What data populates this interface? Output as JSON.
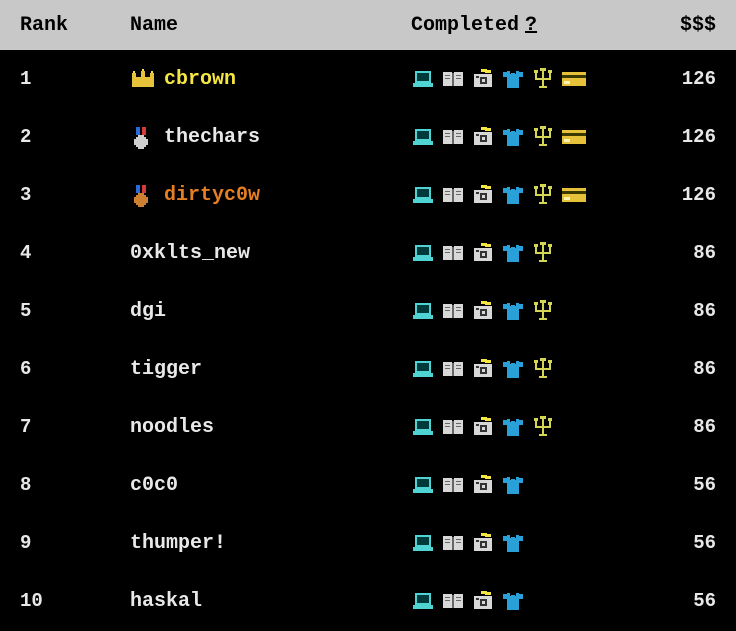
{
  "header": {
    "rank": "Rank",
    "name": "Name",
    "completed": "Completed",
    "help": "?",
    "money": "$$$"
  },
  "badges": {
    "laptop": {
      "color": "#4fd3d3"
    },
    "book": {
      "color": "#d8d8d8"
    },
    "camera": {
      "color": "#d8d8d8",
      "accent": "#f5e642"
    },
    "shirt": {
      "color": "#2aa0d8"
    },
    "trident": {
      "color": "#d4d552"
    },
    "card": {
      "color": "#e6c23a"
    }
  },
  "rows": [
    {
      "rank": "1",
      "name": "cbrown",
      "trophy": "crown",
      "nameClass": "name-1",
      "badges": [
        "laptop",
        "book",
        "camera",
        "shirt",
        "trident",
        "card"
      ],
      "money": "126"
    },
    {
      "rank": "2",
      "name": "thechars",
      "trophy": "silver",
      "nameClass": "name-2",
      "badges": [
        "laptop",
        "book",
        "camera",
        "shirt",
        "trident",
        "card"
      ],
      "money": "126"
    },
    {
      "rank": "3",
      "name": "dirtyc0w",
      "trophy": "bronze",
      "nameClass": "name-3",
      "badges": [
        "laptop",
        "book",
        "camera",
        "shirt",
        "trident",
        "card"
      ],
      "money": "126"
    },
    {
      "rank": "4",
      "name": "0xklts_new",
      "trophy": null,
      "nameClass": "name-default",
      "badges": [
        "laptop",
        "book",
        "camera",
        "shirt",
        "trident"
      ],
      "money": "86"
    },
    {
      "rank": "5",
      "name": "dgi",
      "trophy": null,
      "nameClass": "name-default",
      "badges": [
        "laptop",
        "book",
        "camera",
        "shirt",
        "trident"
      ],
      "money": "86"
    },
    {
      "rank": "6",
      "name": "tigger",
      "trophy": null,
      "nameClass": "name-default",
      "badges": [
        "laptop",
        "book",
        "camera",
        "shirt",
        "trident"
      ],
      "money": "86"
    },
    {
      "rank": "7",
      "name": "noodles",
      "trophy": null,
      "nameClass": "name-default",
      "badges": [
        "laptop",
        "book",
        "camera",
        "shirt",
        "trident"
      ],
      "money": "86"
    },
    {
      "rank": "8",
      "name": "c0c0",
      "trophy": null,
      "nameClass": "name-default",
      "badges": [
        "laptop",
        "book",
        "camera",
        "shirt"
      ],
      "money": "56"
    },
    {
      "rank": "9",
      "name": "thumper!",
      "trophy": null,
      "nameClass": "name-default",
      "badges": [
        "laptop",
        "book",
        "camera",
        "shirt"
      ],
      "money": "56"
    },
    {
      "rank": "10",
      "name": "haskal",
      "trophy": null,
      "nameClass": "name-default",
      "badges": [
        "laptop",
        "book",
        "camera",
        "shirt"
      ],
      "money": "56"
    }
  ]
}
